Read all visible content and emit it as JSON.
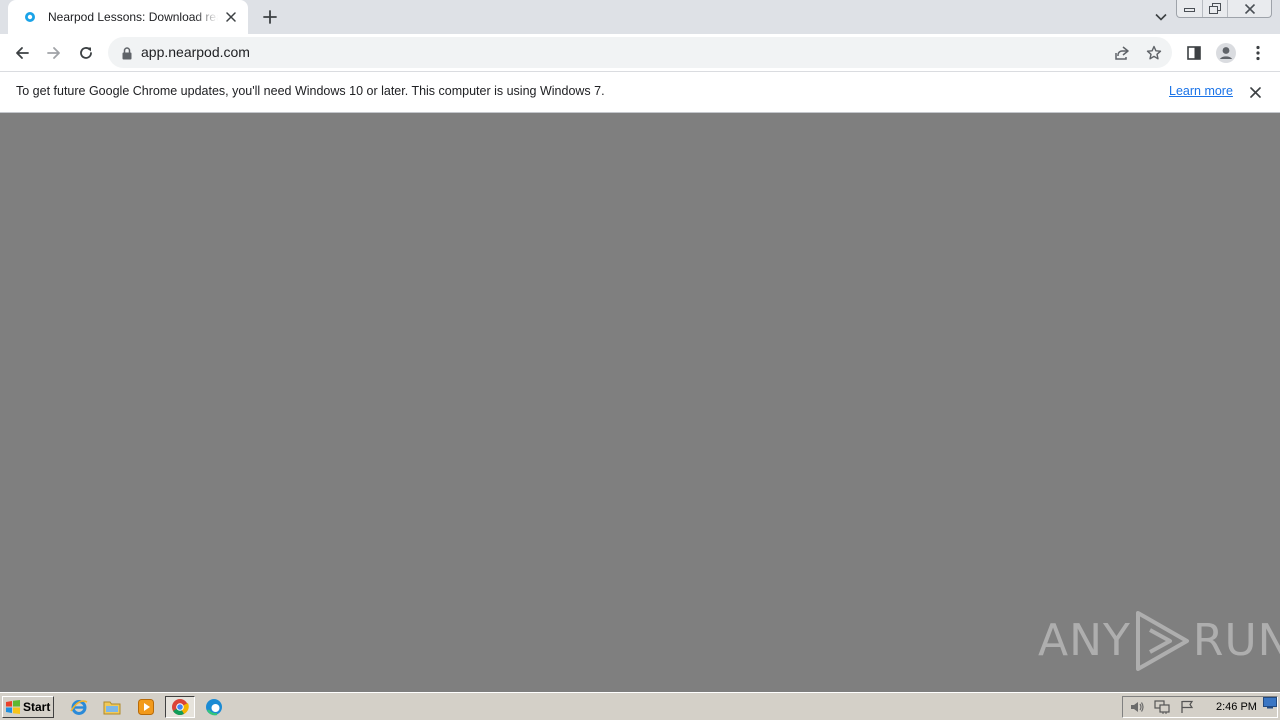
{
  "tab": {
    "title": "Nearpod Lessons: Download ready-to-teach lessons"
  },
  "toolbar": {
    "url": "app.nearpod.com"
  },
  "infobar": {
    "message": "To get future Google Chrome updates, you'll need Windows 10 or later. This computer is using Windows 7.",
    "link_label": "Learn more"
  },
  "watermark": {
    "left_text": "ANY",
    "right_text": "RUN"
  },
  "taskbar": {
    "start_label": "Start",
    "clock": "2:46 PM"
  },
  "colors": {
    "page_background": "#7f7f7f",
    "tab_strip": "#dee1e6",
    "omnibox": "#f1f3f4",
    "link": "#1a73e8",
    "taskbar": "#d4d0c8"
  }
}
